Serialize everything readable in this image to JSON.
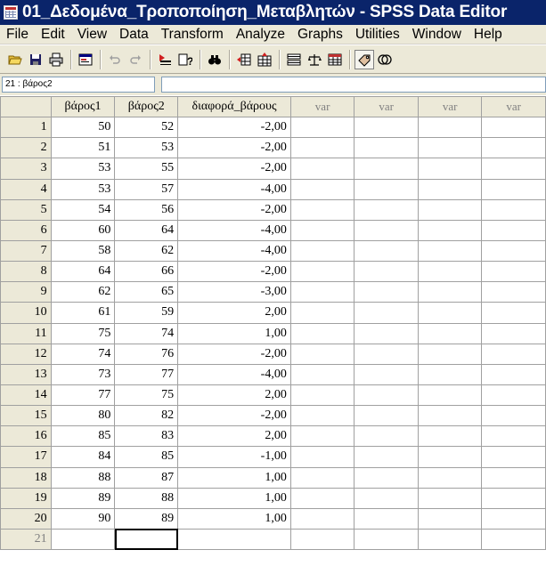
{
  "window": {
    "title": "01_Δεδομένα_Τροποποίηση_Μεταβλητών - SPSS Data Editor"
  },
  "menu": [
    "File",
    "Edit",
    "View",
    "Data",
    "Transform",
    "Analyze",
    "Graphs",
    "Utilities",
    "Window",
    "Help"
  ],
  "toolbar": {
    "icons": [
      "open-icon",
      "save-icon",
      "print-icon",
      "dialog-recall-icon",
      "undo-icon",
      "redo-icon",
      "goto-case-icon",
      "variables-icon",
      "find-icon",
      "insert-case-icon",
      "insert-variable-icon",
      "split-file-icon",
      "weight-cases-icon",
      "select-cases-icon",
      "value-labels-icon",
      "use-sets-icon"
    ]
  },
  "cell_ref": "21 : βάρος2",
  "grid": {
    "columns": [
      "βάρος1",
      "βάρος2",
      "διαφορά_βάρους",
      "var",
      "var",
      "var",
      "var"
    ],
    "rows": [
      [
        "1",
        "50",
        "52",
        "-2,00"
      ],
      [
        "2",
        "51",
        "53",
        "-2,00"
      ],
      [
        "3",
        "53",
        "55",
        "-2,00"
      ],
      [
        "4",
        "53",
        "57",
        "-4,00"
      ],
      [
        "5",
        "54",
        "56",
        "-2,00"
      ],
      [
        "6",
        "60",
        "64",
        "-4,00"
      ],
      [
        "7",
        "58",
        "62",
        "-4,00"
      ],
      [
        "8",
        "64",
        "66",
        "-2,00"
      ],
      [
        "9",
        "62",
        "65",
        "-3,00"
      ],
      [
        "10",
        "61",
        "59",
        "2,00"
      ],
      [
        "11",
        "75",
        "74",
        "1,00"
      ],
      [
        "12",
        "74",
        "76",
        "-2,00"
      ],
      [
        "13",
        "73",
        "77",
        "-4,00"
      ],
      [
        "14",
        "77",
        "75",
        "2,00"
      ],
      [
        "15",
        "80",
        "82",
        "-2,00"
      ],
      [
        "16",
        "85",
        "83",
        "2,00"
      ],
      [
        "17",
        "84",
        "85",
        "-1,00"
      ],
      [
        "18",
        "88",
        "87",
        "1,00"
      ],
      [
        "19",
        "89",
        "88",
        "1,00"
      ],
      [
        "20",
        "90",
        "89",
        "1,00"
      ],
      [
        "21",
        "",
        "",
        ""
      ]
    ]
  }
}
